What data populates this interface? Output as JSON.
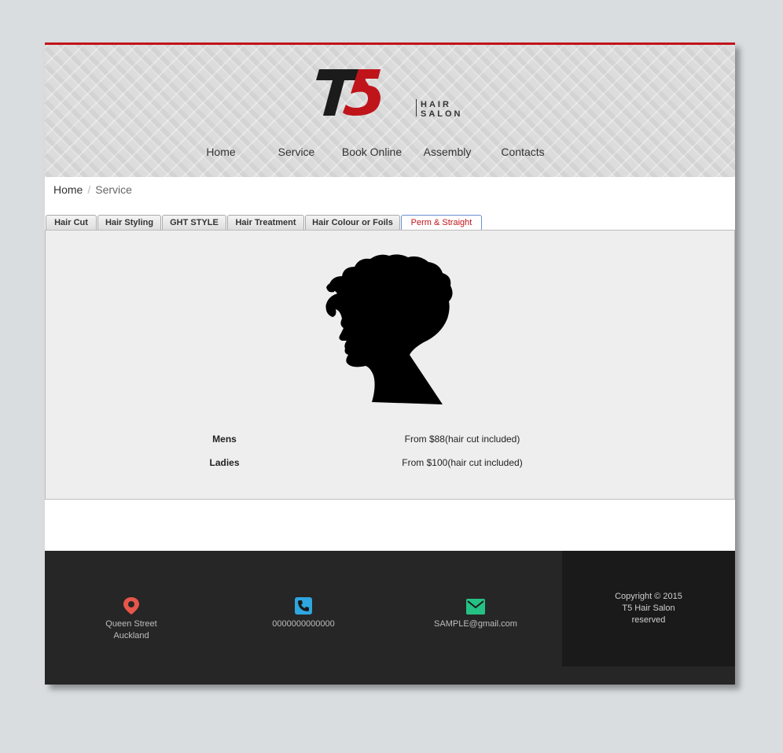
{
  "logo": {
    "mark": "T5",
    "word1": "HAIR",
    "word2": "SALON"
  },
  "nav": [
    {
      "label": "Home"
    },
    {
      "label": "Service"
    },
    {
      "label": "Book Online"
    },
    {
      "label": "Assembly"
    },
    {
      "label": "Contacts"
    }
  ],
  "breadcrumb": {
    "home": "Home",
    "separator": "/",
    "current": "Service"
  },
  "tabs": [
    {
      "label": "Hair Cut"
    },
    {
      "label": "Hair Styling"
    },
    {
      "label": "GHT STYLE"
    },
    {
      "label": "Hair Treatment"
    },
    {
      "label": "Hair Colour or Foils"
    },
    {
      "label": "Perm & Straight",
      "active": true
    }
  ],
  "prices": [
    {
      "label": "Mens",
      "value": "From $88(hair cut included)"
    },
    {
      "label": "Ladies",
      "value": "From $100(hair cut included)"
    }
  ],
  "footer": {
    "address_line1": "Queen Street",
    "address_line2": "Auckland",
    "phone": "0000000000000",
    "email": "SAMPLE@gmail.com",
    "copyright_line1": "Copyright © 2015",
    "copyright_line2": "T5 Hair Salon",
    "copyright_line3": "reserved"
  },
  "colors": {
    "accent": "#c0141b",
    "location_icon": "#e8564a",
    "phone_icon": "#2ea6e0",
    "mail_icon": "#25c184",
    "footer_bg": "#262626"
  },
  "icons": [
    "map-pin-icon",
    "phone-icon",
    "mail-icon",
    "hair-silhouette"
  ]
}
